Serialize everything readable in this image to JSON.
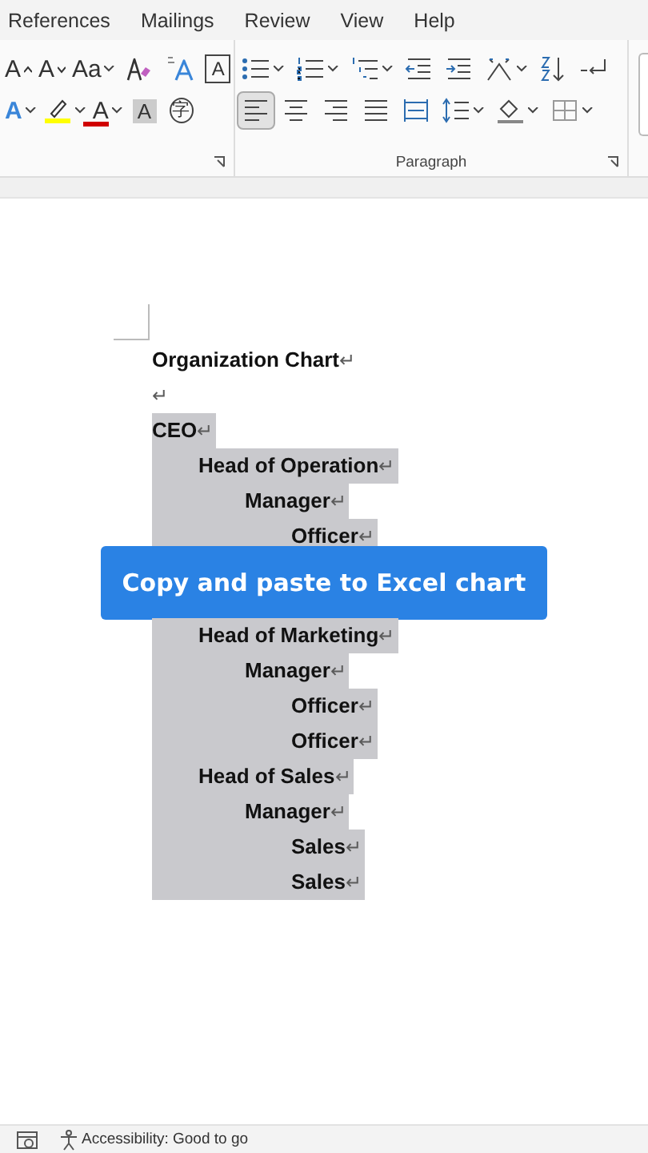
{
  "tabs": [
    {
      "label": "References"
    },
    {
      "label": "Mailings"
    },
    {
      "label": "Review"
    },
    {
      "label": "View"
    },
    {
      "label": "Help"
    }
  ],
  "font_group": {
    "row1": [
      {
        "kind": "grow",
        "label": "A"
      },
      {
        "kind": "shrink",
        "label": "A"
      },
      {
        "kind": "case",
        "label": "Aa",
        "dropdown": true
      },
      {
        "kind": "clear"
      },
      {
        "kind": "effects"
      },
      {
        "kind": "border",
        "label": "A"
      }
    ],
    "row2": [
      {
        "kind": "texteffect",
        "label": "A",
        "dropdown": true
      },
      {
        "kind": "highlight",
        "dropdown": true,
        "color": "#ffff00"
      },
      {
        "kind": "fontcolor",
        "label": "A",
        "dropdown": true,
        "color": "#d00000"
      },
      {
        "kind": "shade",
        "label": "A"
      },
      {
        "kind": "enclose",
        "label": "字"
      }
    ]
  },
  "paragraph_group": {
    "label": "Paragraph",
    "row1": [
      {
        "kind": "bullets",
        "dropdown": true
      },
      {
        "kind": "numbering",
        "dropdown": true
      },
      {
        "kind": "multilevel",
        "dropdown": true
      },
      {
        "kind": "outdent"
      },
      {
        "kind": "indent"
      },
      {
        "kind": "asian",
        "dropdown": true
      },
      {
        "kind": "sort"
      },
      {
        "kind": "marks"
      }
    ],
    "row2": [
      {
        "kind": "left",
        "selected": true
      },
      {
        "kind": "center",
        "selected": false
      },
      {
        "kind": "right",
        "selected": false
      },
      {
        "kind": "justify",
        "selected": false
      },
      {
        "kind": "distribute",
        "selected": false
      },
      {
        "kind": "spacing",
        "dropdown": true
      },
      {
        "kind": "bucket",
        "dropdown": true
      },
      {
        "kind": "borders",
        "dropdown": true
      }
    ]
  },
  "document": {
    "lines": [
      {
        "text": "Organization Chart",
        "mark": "↵",
        "selected": false
      },
      {
        "mark": "↵",
        "selected": false
      },
      {
        "text": "CEO",
        "mark": "↵",
        "selected": true,
        "children": [
          {
            "text": "Head of Operation",
            "mark": "↵",
            "selected": true,
            "children": [
              {
                "text": "Manager",
                "mark": "↵",
                "selected": true,
                "children": [
                  {
                    "text": "Officer",
                    "mark": "↵",
                    "selected": true
                  }
                ]
              }
            ]
          },
          {
            "text": "Head of Marketing",
            "mark": "↵",
            "selected": true,
            "children": [
              {
                "text": "Manager",
                "mark": "↵",
                "selected": true,
                "children": [
                  {
                    "text": "Officer",
                    "mark": "↵",
                    "selected": true
                  },
                  {
                    "text": "Officer",
                    "mark": "↵",
                    "selected": true
                  }
                ]
              }
            ]
          },
          {
            "text": "Head of Sales",
            "mark": "↵",
            "selected": true,
            "children": [
              {
                "text": "Manager",
                "mark": "↵",
                "selected": true,
                "children": [
                  {
                    "text": "Sales",
                    "mark": "↵",
                    "selected": true
                  },
                  {
                    "text": "Sales",
                    "mark": "↵",
                    "selected": true
                  }
                ]
              }
            ]
          }
        ]
      }
    ]
  },
  "banner": {
    "text": "Copy and paste to Excel chart"
  },
  "status_bar": {
    "accessibility": "Accessibility: Good to go"
  }
}
